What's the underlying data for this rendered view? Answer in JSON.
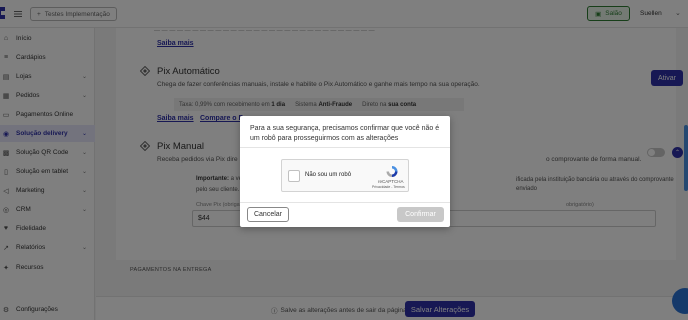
{
  "topbar": {
    "env_label": "Testes Implementação",
    "salao_label": "Salão",
    "user_name": "Suellen"
  },
  "sidebar": {
    "items": [
      {
        "label": "Início",
        "icon": "home-icon",
        "chevron": false,
        "active": false
      },
      {
        "label": "Cardápios",
        "icon": "menu-book-icon",
        "chevron": false,
        "active": false
      },
      {
        "label": "Lojas",
        "icon": "store-icon",
        "chevron": true,
        "active": false
      },
      {
        "label": "Pedidos",
        "icon": "orders-icon",
        "chevron": true,
        "active": false
      },
      {
        "label": "Pagamentos Online",
        "icon": "payment-icon",
        "chevron": false,
        "active": false
      },
      {
        "label": "Solução delivery",
        "icon": "delivery-icon",
        "chevron": true,
        "active": true
      },
      {
        "label": "Solução QR Code",
        "icon": "qr-code-icon",
        "chevron": true,
        "active": false
      },
      {
        "label": "Solução em tablet",
        "icon": "tablet-icon",
        "chevron": true,
        "active": false
      },
      {
        "label": "Marketing",
        "icon": "megaphone-icon",
        "chevron": true,
        "active": false
      },
      {
        "label": "CRM",
        "icon": "crm-icon",
        "chevron": true,
        "active": false
      },
      {
        "label": "Fidelidade",
        "icon": "loyalty-icon",
        "chevron": false,
        "active": false
      },
      {
        "label": "Relatórios",
        "icon": "reports-icon",
        "chevron": true,
        "active": false
      },
      {
        "label": "Recursos",
        "icon": "resources-icon",
        "chevron": false,
        "active": false
      }
    ],
    "settings_label": "Configurações"
  },
  "main": {
    "saiba_mais_1": "Saiba mais",
    "pix_auto": {
      "title": "Pix Automático",
      "description": "Chega de fazer conferências manuais, instale e habilite o Pix Automático e ganhe mais tempo na sua operação.",
      "ativar_label": "Ativar",
      "tax_prefix": "Taxa: 0,99% com recebimento em",
      "tax_days": "1 dia",
      "system_prefix": "Sistema",
      "system_value": "Anti-Fraude",
      "direct_prefix": "Direto na",
      "direct_value": "sua conta",
      "saiba_mais": "Saiba mais",
      "compare": "Compare o P"
    },
    "pix_manual": {
      "title": "Pix Manual",
      "description_left": "Receba pedidos via Pix dire",
      "description_right": "o comprovante de forma manual.",
      "notice_bold": "Importante:",
      "notice_text": "a verificaç",
      "notice_line2": "pelo seu cliente.",
      "notice_right": "ificada pela instituição bancária ou através do comprovante enviado",
      "field_label": "Chave Pix (obrigatório)",
      "field_value": "$44",
      "field_label_right": "obrigatório)"
    },
    "payments_section_title": "PAGAMENTOS NA ENTREGA"
  },
  "bottombar": {
    "hint": "Salve as alterações antes de sair da página",
    "save_label": "Salvar Alterações"
  },
  "modal": {
    "message": "Para a sua segurança, precisamos confirmar que você não é um robô para prosseguirmos com as alterações",
    "recaptcha_label": "Não sou um robô",
    "recaptcha_brand": "reCAPTCHA",
    "recaptcha_terms": "Privacidade - Termos",
    "cancel_label": "Cancelar",
    "confirm_label": "Confirmar"
  },
  "colors": {
    "primary": "#2e31a8",
    "salao_green": "#2e7d32",
    "overlay": "rgba(0,0,0,0.5)"
  }
}
